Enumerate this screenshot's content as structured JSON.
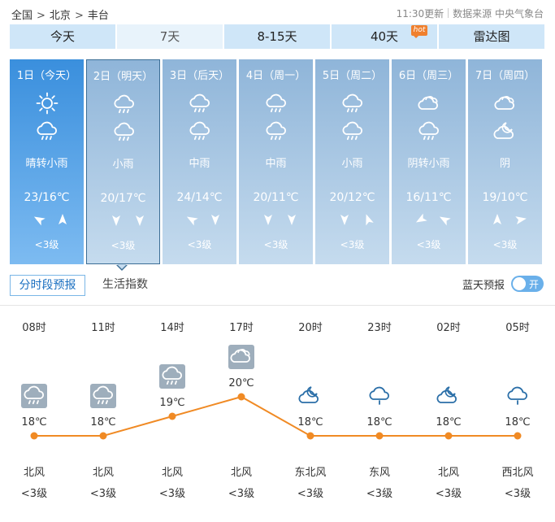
{
  "breadcrumb": {
    "items": [
      "全国",
      "北京",
      "丰台"
    ],
    "separator": ">"
  },
  "meta": {
    "updated": "11:30更新",
    "source": "数据来源 中央气象台"
  },
  "tabs": [
    {
      "label": "今天",
      "active": false
    },
    {
      "label": "7天",
      "active": true
    },
    {
      "label": "8-15天",
      "active": false
    },
    {
      "label": "40天",
      "active": false,
      "badge": "hot"
    },
    {
      "label": "雷达图",
      "active": false
    }
  ],
  "days": [
    {
      "date": "1日（今天）",
      "icons": [
        "sun-icon",
        "rain-cloud-icon"
      ],
      "desc": "晴转小雨",
      "temp": "23/16℃",
      "wind_level": "<3级"
    },
    {
      "date": "2日（明天）",
      "icons": [
        "rain-cloud-icon",
        "rain-cloud-icon"
      ],
      "desc": "小雨",
      "temp": "20/17℃",
      "wind_level": "<3级"
    },
    {
      "date": "3日（后天）",
      "icons": [
        "rain-cloud-icon",
        "rain-cloud-icon"
      ],
      "desc": "中雨",
      "temp": "24/14℃",
      "wind_level": "<3级"
    },
    {
      "date": "4日（周一）",
      "icons": [
        "rain-cloud-icon",
        "rain-cloud-icon"
      ],
      "desc": "中雨",
      "temp": "20/11℃",
      "wind_level": "<3级"
    },
    {
      "date": "5日（周二）",
      "icons": [
        "rain-cloud-icon",
        "rain-cloud-icon"
      ],
      "desc": "小雨",
      "temp": "20/12℃",
      "wind_level": "<3级"
    },
    {
      "date": "6日（周三）",
      "icons": [
        "cloud-icon",
        "rain-cloud-icon"
      ],
      "desc": "阴转小雨",
      "temp": "16/11℃",
      "wind_level": "<3级"
    },
    {
      "date": "7日（周四）",
      "icons": [
        "cloud-icon",
        "moon-cloud-icon"
      ],
      "desc": "阴",
      "temp": "19/10℃",
      "wind_level": "<3级"
    }
  ],
  "subtabs": {
    "hourly": "分时段预报",
    "life": "生活指数"
  },
  "bluesky": {
    "label": "蓝天预报",
    "toggle": "开"
  },
  "hourly": {
    "slots": [
      {
        "time": "08时",
        "icon": "rain-cloud-icon",
        "temp": "18℃",
        "wind": "北风",
        "level": "<3级"
      },
      {
        "time": "11时",
        "icon": "rain-cloud-icon",
        "temp": "18℃",
        "wind": "北风",
        "level": "<3级"
      },
      {
        "time": "14时",
        "icon": "rain-cloud-icon",
        "temp": "19℃",
        "wind": "北风",
        "level": "<3级"
      },
      {
        "time": "17时",
        "icon": "cloud-icon",
        "temp": "20℃",
        "wind": "北风",
        "level": "<3级"
      },
      {
        "time": "20时",
        "icon": "moon-cloud-icon",
        "temp": "18℃",
        "wind": "东北风",
        "level": "<3级"
      },
      {
        "time": "23时",
        "icon": "rain-icon",
        "temp": "18℃",
        "wind": "东风",
        "level": "<3级"
      },
      {
        "time": "02时",
        "icon": "moon-cloud-icon",
        "temp": "18℃",
        "wind": "北风",
        "level": "<3级"
      },
      {
        "time": "05时",
        "icon": "rain-icon",
        "temp": "18℃",
        "wind": "西北风",
        "level": "<3级"
      }
    ],
    "temps": [
      18,
      18,
      19,
      20,
      18,
      18,
      18,
      18
    ],
    "line_color": "#f08a24"
  }
}
